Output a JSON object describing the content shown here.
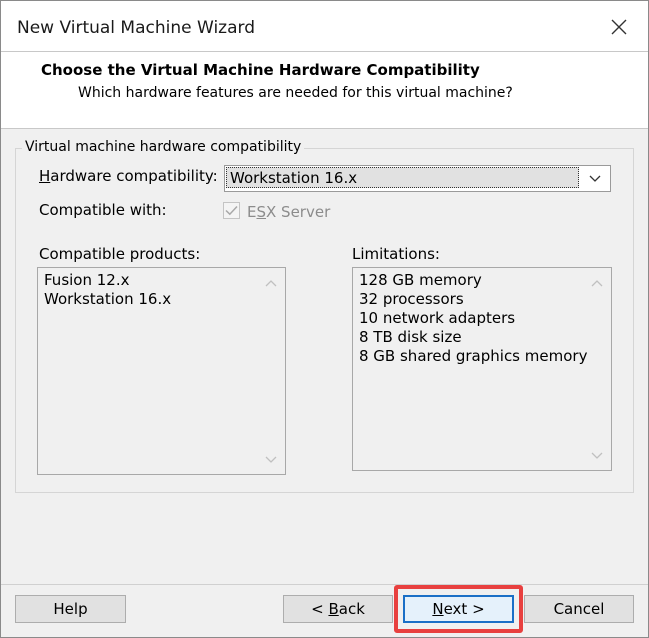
{
  "window": {
    "title": "New Virtual Machine Wizard"
  },
  "header": {
    "title": "Choose the Virtual Machine Hardware Compatibility",
    "subtitle": "Which hardware features are needed for this virtual machine?"
  },
  "group": {
    "label": "Virtual machine hardware compatibility",
    "hardware_label_first": "H",
    "hardware_label_rest": "ardware compatibility:",
    "hardware_value": "Workstation 16.x",
    "compatible_with_label": "Compatible with:",
    "esx_label_first": "E",
    "esx_label_underlined": "S",
    "esx_label_rest": "X Server",
    "esx_checked": true,
    "esx_enabled": false
  },
  "compatible_products": {
    "label": "Compatible products:",
    "items": [
      "Fusion 12.x",
      "Workstation 16.x"
    ]
  },
  "limitations": {
    "label": "Limitations:",
    "items": [
      "128 GB memory",
      "32 processors",
      "10 network adapters",
      "8 TB disk size",
      "8 GB shared graphics memory"
    ]
  },
  "buttons": {
    "help": "Help",
    "back_prefix": "< ",
    "back_underlined": "B",
    "back_rest": "ack",
    "next_underlined": "N",
    "next_rest": "ext >",
    "cancel": "Cancel"
  },
  "colors": {
    "highlight": "#e8403f",
    "default_button_border": "#1b6fc6"
  },
  "icons": {
    "close": "close-icon",
    "dropdown": "chevron-down-icon",
    "check": "checkmark-icon",
    "scroll_up": "chevron-up-icon",
    "scroll_down": "chevron-down-icon"
  }
}
